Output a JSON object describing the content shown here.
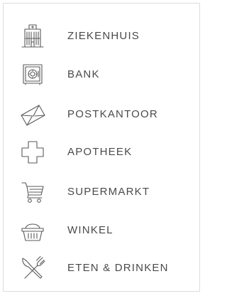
{
  "categories": [
    {
      "label": "ZIEKENHUIS",
      "icon": "hospital-icon"
    },
    {
      "label": "BANK",
      "icon": "safe-icon"
    },
    {
      "label": "POSTKANTOOR",
      "icon": "envelope-icon"
    },
    {
      "label": "APOTHEEK",
      "icon": "pharmacy-cross-icon"
    },
    {
      "label": "SUPERMARKT",
      "icon": "shopping-cart-icon"
    },
    {
      "label": "WINKEL",
      "icon": "shopping-basket-icon"
    },
    {
      "label": "ETEN & DRINKEN",
      "icon": "fork-knife-icon"
    }
  ]
}
